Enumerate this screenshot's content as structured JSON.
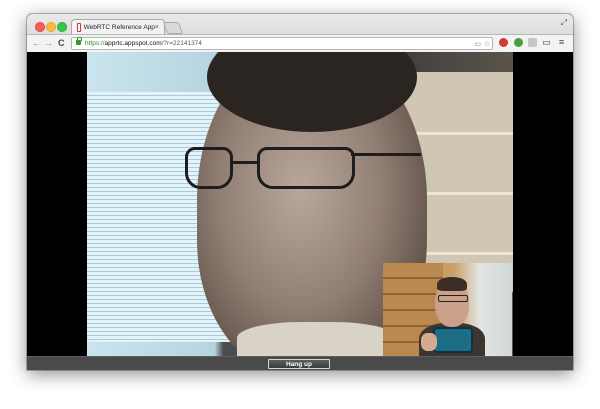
{
  "browser": {
    "tab_title": "WebRTC Reference App",
    "tab_close": "×",
    "url_scheme": "https://",
    "url_host": "apprtc.appspot.com",
    "url_path": "/?r=22141374"
  },
  "icons": {
    "back": "←",
    "forward": "→",
    "reload": "C",
    "fullscreen": "⤢",
    "page": "▭",
    "star": "☆",
    "cast": "▭",
    "menu": "≡"
  },
  "colors": {
    "secure_green": "#2b8a2b",
    "window_bg": "#000000",
    "bottom_bar": "#4a4a4a"
  },
  "call": {
    "hangup_label": "Hang up"
  }
}
